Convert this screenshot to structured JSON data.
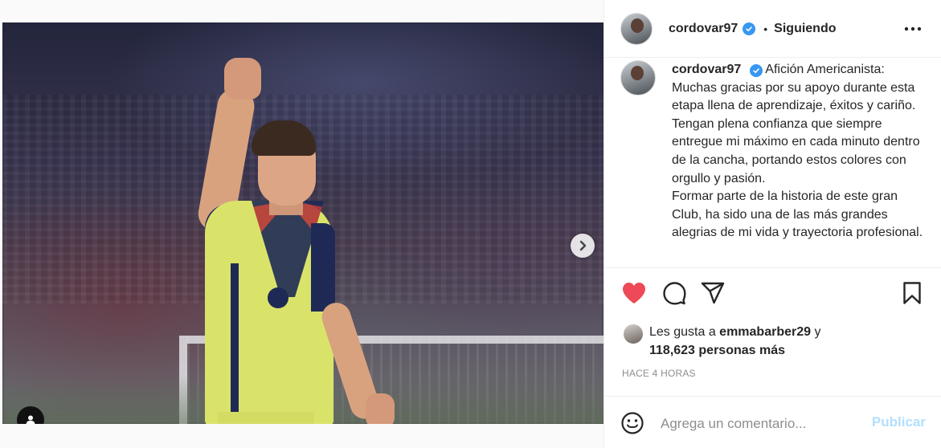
{
  "post": {
    "username": "cordovar97",
    "follow_status": "Siguiendo",
    "bullet": "•",
    "more_icon": "more-horizontal-icon"
  },
  "caption": {
    "username": "cordovar97",
    "lines": [
      "Afición Americanista:",
      "Muchas gracias por su apoyo durante esta etapa llena de aprendizaje, éxitos y cariño.",
      "Tengan plena confianza que siempre entregue mi máximo en cada minuto dentro de la cancha, portando estos colores con orgullo y pasión.",
      "Formar parte de la historia de este gran Club, ha sido una de las más grandes alegrias de mi vida y trayectoria",
      "profesional."
    ]
  },
  "likes": {
    "prefix": "Les gusta a ",
    "user": "emmabarber29",
    "middle": " y ",
    "count": "118,623 personas más"
  },
  "timestamp": "HACE 4 HORAS",
  "comment": {
    "placeholder": "Agrega un comentario...",
    "publish_label": "Publicar"
  },
  "colors": {
    "like_red": "#ed4956",
    "verified_blue": "#3897f0",
    "publish_disabled": "#b2dffc",
    "carousel_active": "#1a8cff"
  },
  "carousel": {
    "total": 4,
    "active_index": 0
  }
}
